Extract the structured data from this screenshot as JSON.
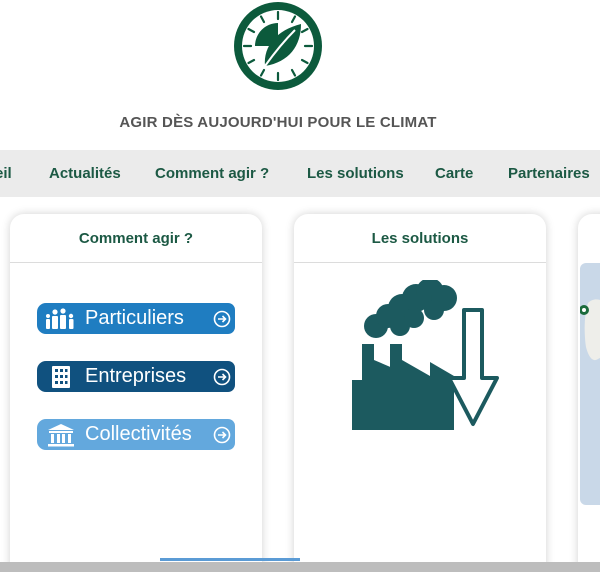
{
  "header": {
    "tagline": "AGIR DÈS AUJOURD'HUI POUR LE CLIMAT"
  },
  "nav": {
    "items": [
      {
        "label": "eil"
      },
      {
        "label": "Actualités"
      },
      {
        "label": "Comment agir ?"
      },
      {
        "label": "Les solutions"
      },
      {
        "label": "Carte"
      },
      {
        "label": "Partenaires"
      }
    ]
  },
  "panels": {
    "comment_agir": {
      "title": "Comment agir ?",
      "buttons": [
        {
          "label": "Particuliers",
          "icon": "family-icon",
          "color": "#1f7dc1"
        },
        {
          "label": "Entreprises",
          "icon": "building-icon",
          "color": "#10517f"
        },
        {
          "label": "Collectivités",
          "icon": "townhall-icon",
          "color": "#63a8dd"
        }
      ]
    },
    "solutions": {
      "title": "Les solutions",
      "icon": "factory-emissions-down-icon"
    },
    "carte": {
      "icon": "map-image"
    }
  },
  "colors": {
    "brand_green": "#1c5944",
    "logo_green": "#0c5a3c",
    "factory_teal": "#1c5a5f",
    "nav_bg": "#ebebeb"
  }
}
